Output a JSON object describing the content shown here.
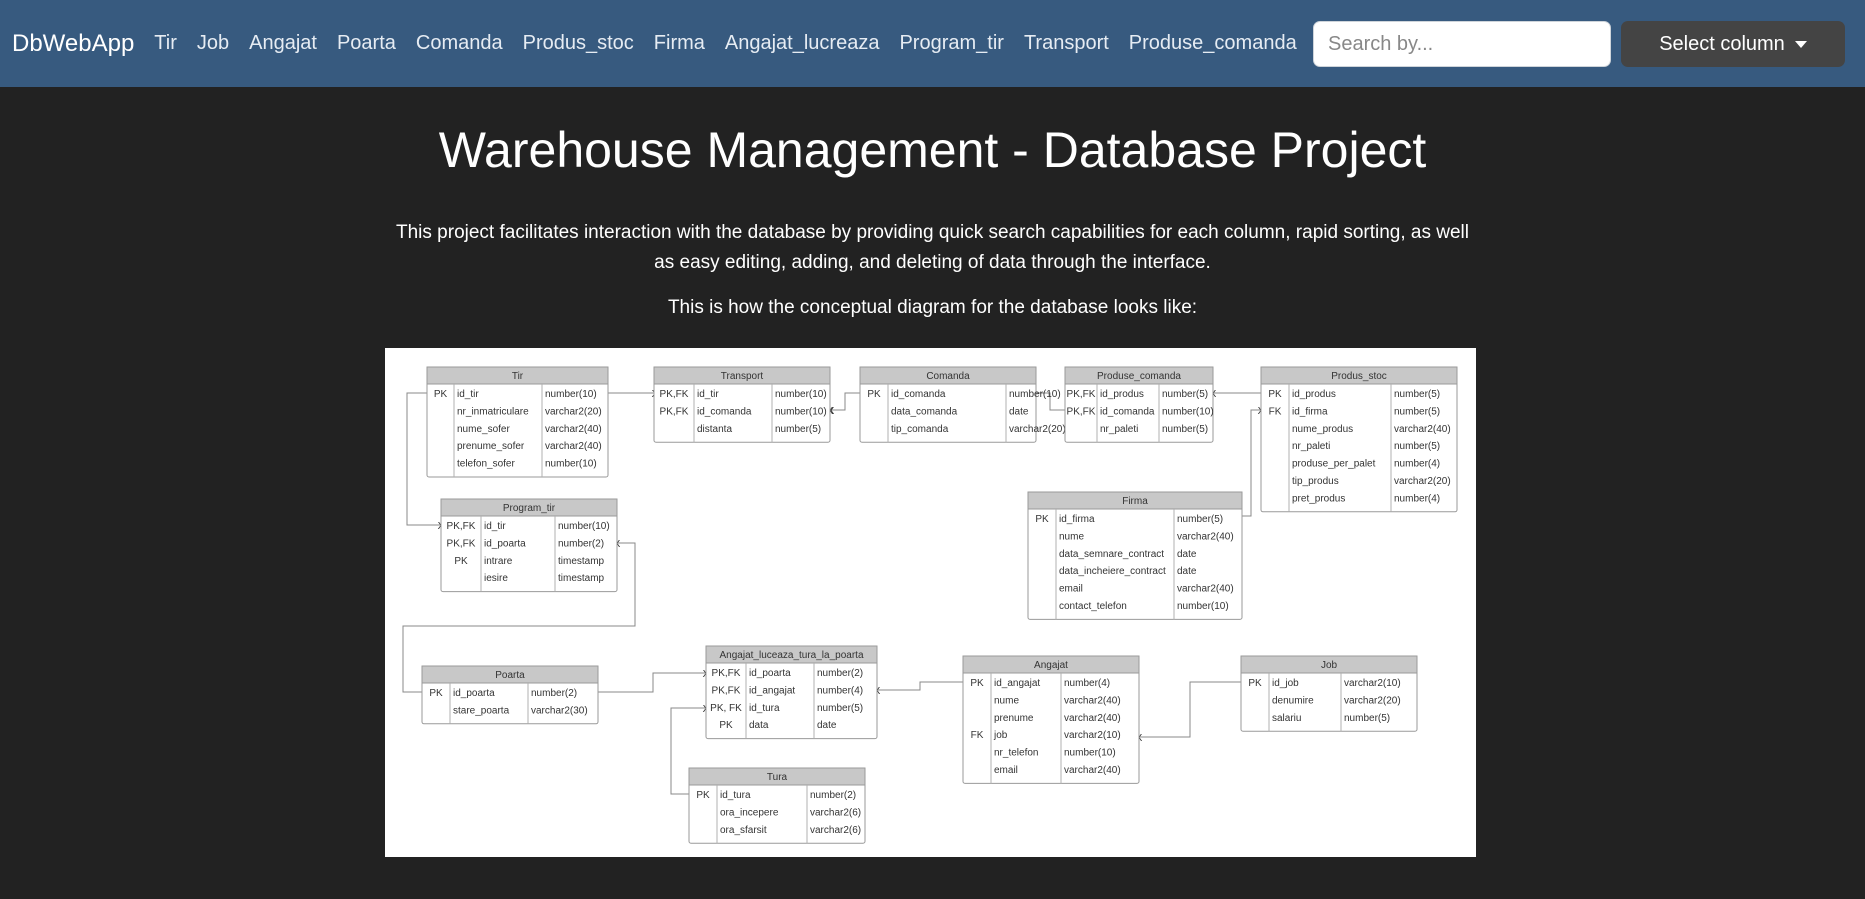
{
  "navbar": {
    "brand": "DbWebApp",
    "links": [
      "Tir",
      "Job",
      "Angajat",
      "Poarta",
      "Comanda",
      "Produs_stoc",
      "Firma",
      "Angajat_lucreaza",
      "Program_tir",
      "Transport",
      "Produse_comanda"
    ],
    "search_placeholder": "Search by...",
    "select_label": "Select column"
  },
  "main": {
    "title": "Warehouse Management - Database Project",
    "description": "This project facilitates interaction with the database by providing quick search capabilities for each column, rapid sorting, as well as easy editing, adding, and deleting of data through the interface.",
    "diagram_caption": "This is how the conceptual diagram for the database looks like:"
  },
  "diagram": {
    "tables": [
      {
        "name": "Tir",
        "rows": [
          [
            "PK",
            "id_tir",
            "number(10)"
          ],
          [
            "",
            "nr_inmatriculare",
            "varchar2(20)"
          ],
          [
            "",
            "nume_sofer",
            "varchar2(40)"
          ],
          [
            "",
            "prenume_sofer",
            "varchar2(40)"
          ],
          [
            "",
            "telefon_sofer",
            "number(10)"
          ]
        ]
      },
      {
        "name": "Transport",
        "rows": [
          [
            "PK,FK",
            "id_tir",
            "number(10)"
          ],
          [
            "PK,FK",
            "id_comanda",
            "number(10)"
          ],
          [
            "",
            "distanta",
            "number(5)"
          ]
        ]
      },
      {
        "name": "Comanda",
        "rows": [
          [
            "PK",
            "id_comanda",
            "number(10)"
          ],
          [
            "",
            "data_comanda",
            "date"
          ],
          [
            "",
            "tip_comanda",
            "varchar2(20)"
          ]
        ]
      },
      {
        "name": "Produse_comanda",
        "rows": [
          [
            "PK,FK",
            "id_produs",
            "number(5)"
          ],
          [
            "PK,FK",
            "id_comanda",
            "number(10)"
          ],
          [
            "",
            "nr_paleti",
            "number(5)"
          ]
        ]
      },
      {
        "name": "Produs_stoc",
        "rows": [
          [
            "PK",
            "id_produs",
            "number(5)"
          ],
          [
            "FK",
            "id_firma",
            "number(5)"
          ],
          [
            "",
            "nume_produs",
            "varchar2(40)"
          ],
          [
            "",
            "nr_paleti",
            "number(5)"
          ],
          [
            "",
            "produse_per_palet",
            "number(4)"
          ],
          [
            "",
            "tip_produs",
            "varchar2(20)"
          ],
          [
            "",
            "pret_produs",
            "number(4)"
          ]
        ]
      },
      {
        "name": "Program_tir",
        "rows": [
          [
            "PK,FK",
            "id_tir",
            "number(10)"
          ],
          [
            "PK,FK",
            "id_poarta",
            "number(2)"
          ],
          [
            "PK",
            "intrare",
            "timestamp"
          ],
          [
            "",
            "iesire",
            "timestamp"
          ]
        ]
      },
      {
        "name": "Firma",
        "rows": [
          [
            "PK",
            "id_firma",
            "number(5)"
          ],
          [
            "",
            "nume",
            "varchar2(40)"
          ],
          [
            "",
            "data_semnare_contract",
            "date"
          ],
          [
            "",
            "data_incheiere_contract",
            "date"
          ],
          [
            "",
            "email",
            "varchar2(40)"
          ],
          [
            "",
            "contact_telefon",
            "number(10)"
          ]
        ]
      },
      {
        "name": "Poarta",
        "rows": [
          [
            "PK",
            "id_poarta",
            "number(2)"
          ],
          [
            "",
            "stare_poarta",
            "varchar2(30)"
          ]
        ]
      },
      {
        "name": "Angajat_luceaza_tura_la_poarta",
        "rows": [
          [
            "PK,FK",
            "id_poarta",
            "number(2)"
          ],
          [
            "PK,FK",
            "id_angajat",
            "number(4)"
          ],
          [
            "PK, FK",
            "id_tura",
            "number(5)"
          ],
          [
            "PK",
            "data",
            "date"
          ]
        ]
      },
      {
        "name": "Angajat",
        "rows": [
          [
            "PK",
            "id_angajat",
            "number(4)"
          ],
          [
            "",
            "nume",
            "varchar2(40)"
          ],
          [
            "",
            "prenume",
            "varchar2(40)"
          ],
          [
            "FK",
            "job",
            "varchar2(10)"
          ],
          [
            "",
            "nr_telefon",
            "number(10)"
          ],
          [
            "",
            "email",
            "varchar2(40)"
          ]
        ]
      },
      {
        "name": "Job",
        "rows": [
          [
            "PK",
            "id_job",
            "varchar2(10)"
          ],
          [
            "",
            "denumire",
            "varchar2(20)"
          ],
          [
            "",
            "salariu",
            "number(5)"
          ]
        ]
      },
      {
        "name": "Tura",
        "rows": [
          [
            "PK",
            "id_tura",
            "number(2)"
          ],
          [
            "",
            "ora_incepere",
            "varchar2(6)"
          ],
          [
            "",
            "ora_sfarsit",
            "varchar2(6)"
          ]
        ]
      }
    ]
  }
}
